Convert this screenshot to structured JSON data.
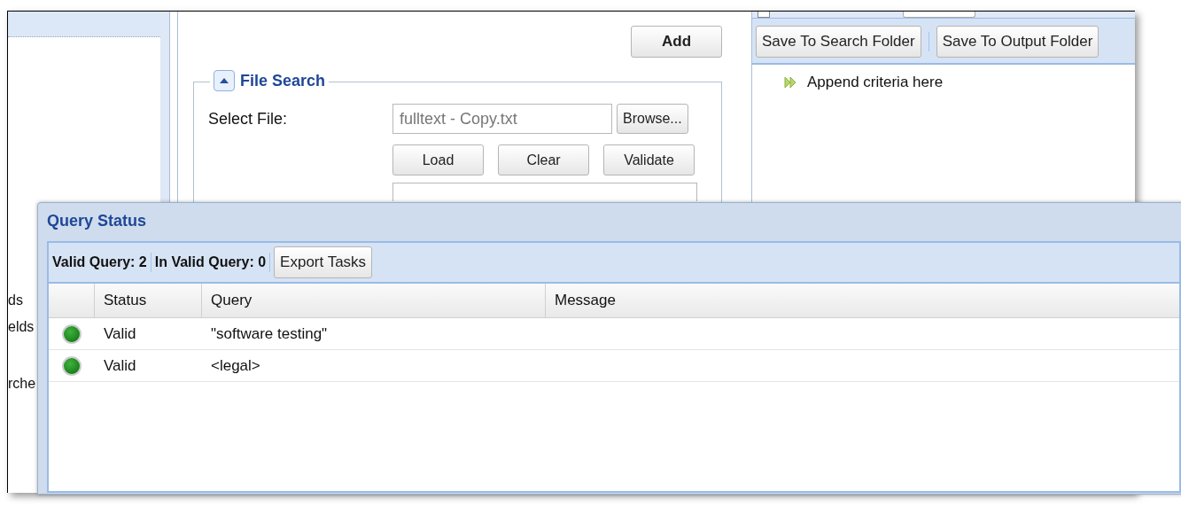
{
  "left_panel": {
    "items": [
      {
        "label": "ds"
      },
      {
        "label": "elds"
      },
      {
        "label": "rche"
      }
    ]
  },
  "middle_panel": {
    "add_button": "Add",
    "file_search": {
      "title": "File Search",
      "expanded": true,
      "select_file_label": "Select File:",
      "file_value": "fulltext - Copy.txt",
      "browse_button": "Browse...",
      "buttons": [
        "Load",
        "Clear",
        "Validate"
      ]
    }
  },
  "right_panel": {
    "stemming_checkbox": {
      "checked": false
    },
    "toolbar_buttons": [
      "Save To Search Folder",
      "Save To Output Folder"
    ],
    "criteria_hint": "Append criteria here"
  },
  "dialog": {
    "title": "Query Status",
    "summary": [
      "Valid Query: 2",
      "In Valid Query: 0"
    ],
    "export_button": "Export Tasks",
    "columns": [
      "Status",
      "Query",
      "Message"
    ],
    "rows": [
      {
        "valid": true,
        "status": "Valid",
        "query": "\"software testing\""
      },
      {
        "valid": true,
        "status": "Valid",
        "query": "<legal>"
      }
    ]
  }
}
